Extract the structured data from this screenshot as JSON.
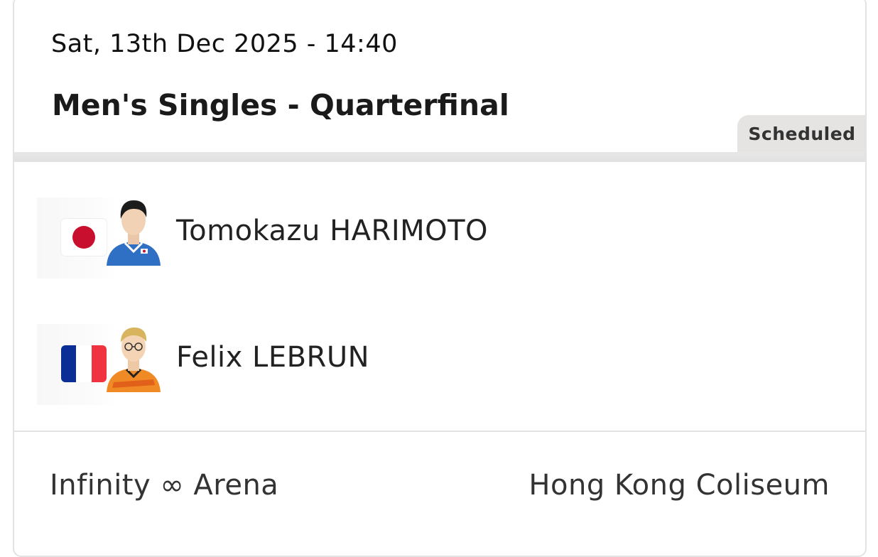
{
  "match": {
    "datetime": "Sat, 13th Dec 2025 - 14:40",
    "round": "Men's Singles - Quarterfinal",
    "status": "Scheduled"
  },
  "players": [
    {
      "name": "Tomokazu HARIMOTO",
      "flag_icon": "japan-flag-icon",
      "flag_colors": {
        "field": "#ffffff",
        "disc": "#c8102e"
      },
      "jersey_color": "#2f6fc4"
    },
    {
      "name": "Felix LEBRUN",
      "flag_icon": "france-flag-icon",
      "flag_colors": {
        "blue": "#0a2d96",
        "white": "#ffffff",
        "red": "#ef3340"
      },
      "jersey_color": "#f08a24"
    }
  ],
  "footer": {
    "venue": "Infinity ∞ Arena",
    "location": "Hong Kong Coliseum"
  },
  "colors": {
    "card_border": "#e3e3e3",
    "badge_bg": "#e6e4e3",
    "text_primary": "#1a1a1a"
  }
}
